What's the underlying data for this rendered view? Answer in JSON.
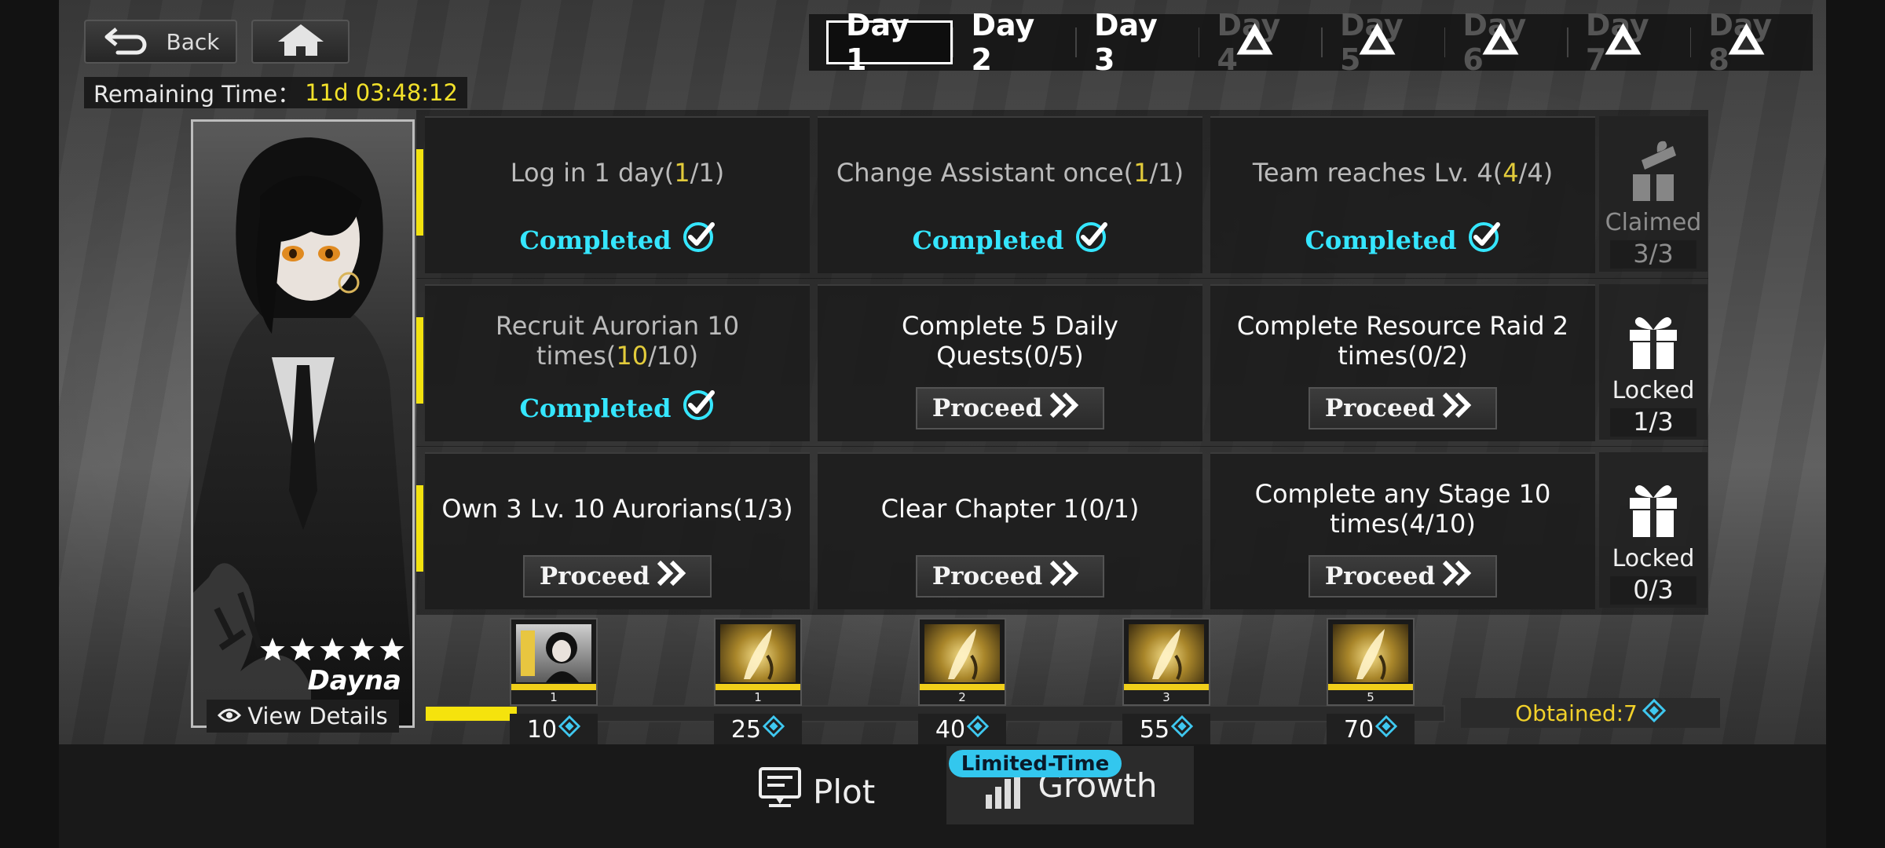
{
  "header": {
    "back_label": "Back",
    "remaining_label": "Remaining Time：",
    "remaining_value": "11d 03:48:12"
  },
  "day_tabs": [
    {
      "label": "Day 1",
      "state": "active"
    },
    {
      "label": "Day 2",
      "state": "unlocked"
    },
    {
      "label": "Day 3",
      "state": "unlocked"
    },
    {
      "label": "Day 4",
      "state": "locked"
    },
    {
      "label": "Day 5",
      "state": "locked"
    },
    {
      "label": "Day 6",
      "state": "locked"
    },
    {
      "label": "Day 7",
      "state": "locked"
    },
    {
      "label": "Day 8",
      "state": "locked"
    }
  ],
  "character": {
    "name": "Dayna",
    "stars": 5,
    "view_details_label": "View Details"
  },
  "rows": [
    {
      "tasks": [
        {
          "text": "Log in 1 day",
          "current": "1",
          "total": "1",
          "status": "Completed"
        },
        {
          "text": "Change Assistant once",
          "current": "1",
          "total": "1",
          "status": "Completed"
        },
        {
          "text": "Team reaches Lv. 4",
          "current": "4",
          "total": "4",
          "status": "Completed"
        }
      ],
      "reward": {
        "state": "Claimed",
        "count": "3/3"
      }
    },
    {
      "tasks": [
        {
          "text": "Recruit Aurorian 10 times",
          "current": "10",
          "total": "10",
          "status": "Completed"
        },
        {
          "text": "Complete 5 Daily Quests",
          "current": "0",
          "total": "5",
          "status": "Proceed"
        },
        {
          "text": "Complete Resource Raid 2 times",
          "current": "0",
          "total": "2",
          "status": "Proceed"
        }
      ],
      "reward": {
        "state": "Locked",
        "count": "1/3"
      }
    },
    {
      "tasks": [
        {
          "text": "Own 3 Lv. 10 Aurorians",
          "current": "1",
          "total": "3",
          "status": "Proceed"
        },
        {
          "text": "Clear Chapter 1",
          "current": "0",
          "total": "1",
          "status": "Proceed"
        },
        {
          "text": "Complete any Stage 10 times",
          "current": "4",
          "total": "10",
          "status": "Proceed"
        }
      ],
      "reward": {
        "state": "Locked",
        "count": "0/3"
      }
    }
  ],
  "milestones": [
    {
      "points": "10",
      "qty": "1",
      "item": "character-card"
    },
    {
      "points": "25",
      "qty": "1",
      "item": "golden-quill"
    },
    {
      "points": "40",
      "qty": "2",
      "item": "golden-quill"
    },
    {
      "points": "55",
      "qty": "3",
      "item": "golden-quill"
    },
    {
      "points": "70",
      "qty": "5",
      "item": "golden-quill"
    }
  ],
  "progress": {
    "obtained": 7,
    "max": 70
  },
  "obtained_label": "Obtained:7",
  "bottom_nav": {
    "plot_label": "Plot",
    "growth_label": "Growth",
    "limited_badge": "Limited-Time"
  },
  "colors": {
    "accent_yellow": "#f2e20f",
    "completed_cyan": "#35e6ff",
    "badge_blue": "#33c7ee",
    "progress_highlight": "#e2cb3b"
  }
}
